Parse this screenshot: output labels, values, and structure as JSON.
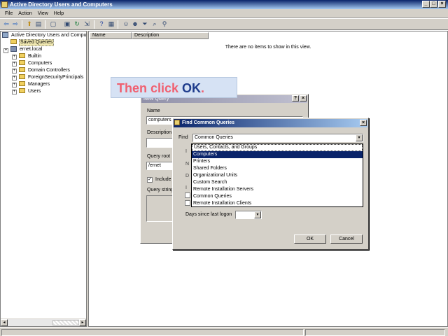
{
  "window": {
    "title": "Active Directory Users and Computers"
  },
  "window_buttons": {
    "minimize": "_",
    "maximize": "□",
    "close": "×"
  },
  "menu": [
    "File",
    "Action",
    "View",
    "Help"
  ],
  "toolbar": {
    "back": "⇦",
    "forward": "⇨",
    "up": "⬆",
    "show_tree": "▤",
    "copy": "▢",
    "properties": "▣",
    "refresh": "↻",
    "export": "⇲",
    "help": "?",
    "console": "▦",
    "new_user": "☺",
    "new_group": "☻",
    "filter": "⏷",
    "find": "⌕",
    "add_to_group": "⚲"
  },
  "tree": {
    "root": "Active Directory Users and Comput",
    "saved_queries": "Saved Queries",
    "domain": "ernet.local",
    "children": [
      "Builtin",
      "Computers",
      "Domain Controllers",
      "ForeignSecurityPrincipals",
      "Managers",
      "Users"
    ]
  },
  "list": {
    "columns": [
      "Name",
      "Description"
    ],
    "empty_message": "There are no items to show in this view."
  },
  "callout": {
    "prefix": "Then click ",
    "ok": "OK",
    "dot": "."
  },
  "bg_dialog": {
    "title": "New Query",
    "name_label": "Name",
    "name_value": "computers",
    "description_label": "Description",
    "query_root_label": "Query root",
    "query_root_value": "/ernet",
    "include_subcontainers": "Include",
    "query_string_label": "Query string",
    "help_btn": "?",
    "close_btn": "×"
  },
  "fg_dialog": {
    "title": "Find Common Queries",
    "find_label": "Find",
    "find_value": "Common Queries",
    "options": [
      "Users, Contacts, and Groups",
      "Computers",
      "Printers",
      "Shared Folders",
      "Organizational Units",
      "Custom Search",
      "Remote Installation Servers",
      "Common Queries",
      "Remote Installation Clients"
    ],
    "selected_index": 1,
    "days_since_logon_label": "Days since last logon",
    "ok": "OK",
    "cancel": "Cancel",
    "close_btn": "×"
  },
  "icons": {
    "combo_arrow": "▾",
    "expand": "+",
    "check": "✓",
    "scroll_left": "◂",
    "scroll_right": "▸",
    "underflow_l": "I",
    "underflow_n": "N",
    "underflow_d": "D",
    "underflow_i": "I"
  },
  "colors": {
    "title_bar": "#0a246a",
    "selection": "#0a246a",
    "callout_text": "#f06070",
    "callout_ok": "#1e3c8c"
  }
}
